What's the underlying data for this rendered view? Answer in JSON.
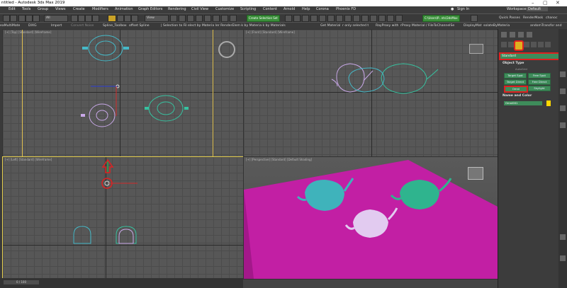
{
  "window": {
    "title": "ntitled - Autodesk 3ds Max 2019",
    "controls": [
      "–",
      "▢",
      "✕"
    ]
  },
  "menu": {
    "items": [
      "Edit",
      "Tools",
      "Group",
      "Views",
      "Create",
      "Modifiers",
      "Animation",
      "Graph Editors",
      "Rendering",
      "Civil View",
      "Customize",
      "Scripting",
      "Content",
      "Arnold",
      "Help",
      "Corona",
      "Phoenix FD"
    ],
    "sign_in": "Sign In",
    "workspaces_label": "Workspaces:",
    "workspaces_value": "Default"
  },
  "toolbar1": {
    "filter_value": "All",
    "view_value": "View",
    "selection_set": "Create Selection Set",
    "path_value": "C:\\Users\\P...nts\\3dsMax",
    "quick_passes": "Quick Passes",
    "render_mask": "RenderMask",
    "chanel": "chanoc"
  },
  "toolbar2": {
    "items": [
      "eaMultiMate",
      "DIXG",
      "Import",
      "Convert Noise",
      "Spline_Toolbox",
      "offset Spline",
      "| Selection to Fil elect by Materia ler RenderElem k by Materia k by Materials",
      "Get Material",
      "r only selected t",
      "RayProxy with",
      "rProxy Material / FileToChannelSe",
      "DisplayMat",
      "solateByMateria",
      "andomTransfor and"
    ]
  },
  "viewports": {
    "top_left_label": "[+] [Top] [Standard] [Wireframe]",
    "top_right_label": "[+] [Front] [Standard] [Wireframe]",
    "bottom_left_label": "[+] [Left] [Standard] [Wireframe]",
    "bottom_right_label": "[+] [Perspective] [Standard] [Default Shading]"
  },
  "command_panel": {
    "category_dropdown": "Standard",
    "object_type_title": "Object Type",
    "autogrid": "AutoGrid",
    "buttons": [
      "Target Spot",
      "Free Spot",
      "Target Direct",
      "Free Direct",
      "Omni",
      "Skylight"
    ],
    "name_color_title": "Name and Color",
    "name_value": "Omni001",
    "swatch_color": "#ffd700"
  },
  "status": {
    "frame": "0 / 100"
  }
}
